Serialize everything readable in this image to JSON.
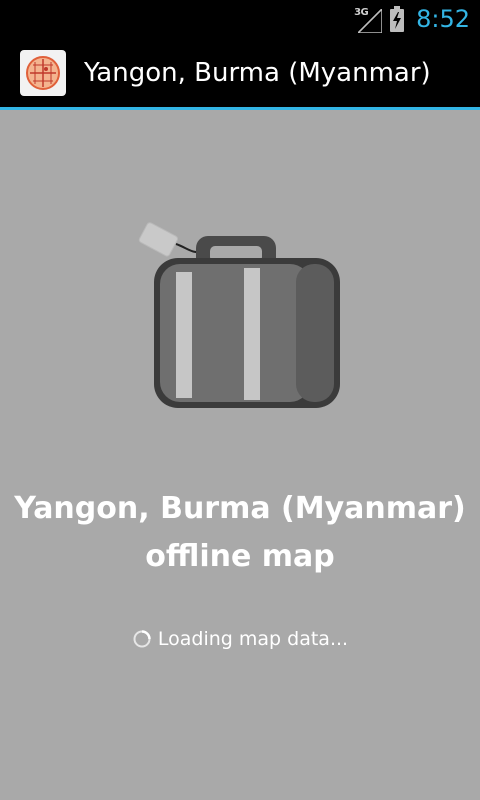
{
  "status_bar": {
    "network_type": "3G",
    "time": "8:52",
    "icons": [
      "signal-icon",
      "battery-charging-icon"
    ]
  },
  "action_bar": {
    "app_icon": "map-app-icon",
    "title": "Yangon, Burma (Myanmar)"
  },
  "main": {
    "illustration": "suitcase-icon",
    "headline_line1": "Yangon, Burma (Myanmar)",
    "headline_line2": "offline map",
    "loading_text": "Loading map data..."
  },
  "colors": {
    "accent": "#33b5e5",
    "background": "#a9a9a9",
    "status_bar": "#000000"
  }
}
